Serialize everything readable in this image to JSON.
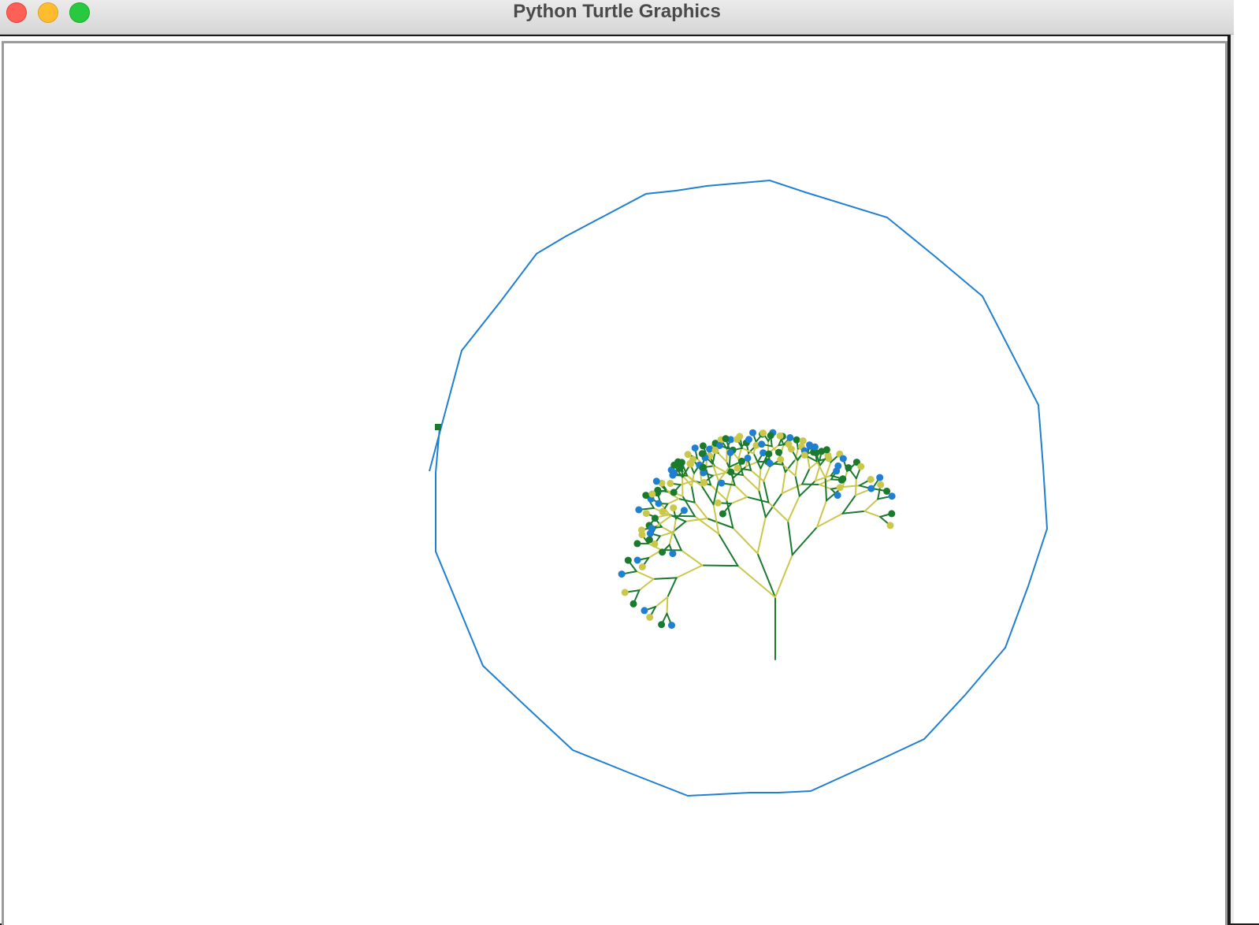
{
  "window": {
    "title": "Python Turtle Graphics",
    "buttons": [
      "close",
      "minimize",
      "zoom"
    ]
  },
  "colors": {
    "circle": "#1f7fd1",
    "branch_dark": "#1a7a2e",
    "branch_light": "#c9c84a",
    "leaf_blue": "#1f7fd1",
    "leaf_green": "#1a7a2e",
    "leaf_yellow": "#c9c84a",
    "background": "#ffffff"
  },
  "drawing": {
    "shapes": [
      "polygon-outline",
      "fractal-tree"
    ],
    "leaf_shape": "turtle-dot"
  }
}
